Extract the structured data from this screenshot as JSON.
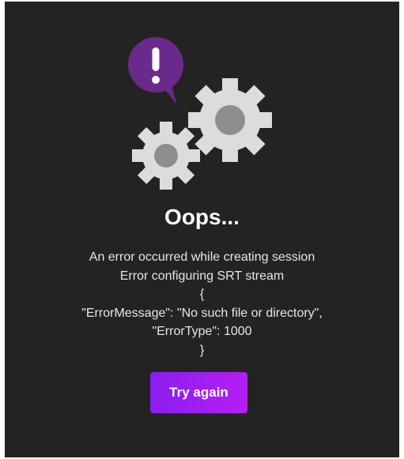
{
  "error_page": {
    "title": "Oops...",
    "message_lines": [
      "An error occurred while creating session",
      "Error configuring SRT stream",
      "{",
      "\"ErrorMessage\": \"No such file or directory\",",
      "\"ErrorType\": 1000",
      "}"
    ],
    "retry_label": "Try again"
  },
  "icons": {
    "alert": "exclamation-speech-bubble-icon",
    "gears": "gears-icon"
  },
  "colors": {
    "background": "#232323",
    "accent_start": "#8a1ef0",
    "accent_end": "#b51ef5",
    "bubble": "#6a2a8c",
    "gear": "#dcdcdc",
    "gear_hub": "#8e8e8e"
  }
}
